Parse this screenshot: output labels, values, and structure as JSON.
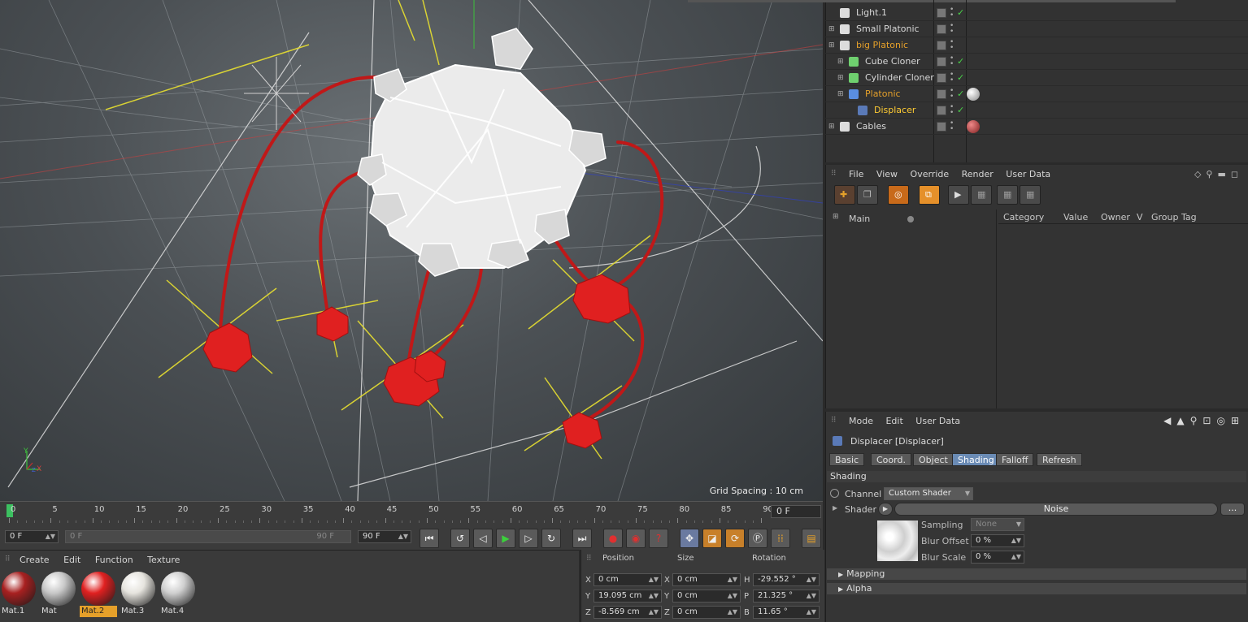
{
  "viewport": {
    "grid_spacing": "Grid Spacing : 10 cm",
    "axis_y": "Y",
    "axis_x": "X",
    "axis_z": "Z"
  },
  "timeline": {
    "ticks": [
      "0",
      "5",
      "10",
      "15",
      "20",
      "25",
      "30",
      "35",
      "40",
      "45",
      "50",
      "55",
      "60",
      "65",
      "70",
      "75",
      "80",
      "85",
      "90"
    ],
    "current_frame": "0 F"
  },
  "transport": {
    "start_frame": "0 F",
    "range_start": "0 F",
    "range_end": "90 F",
    "end_frame": "90 F"
  },
  "materials": {
    "menu": [
      "Create",
      "Edit",
      "Function",
      "Texture"
    ],
    "items": [
      {
        "label": "Mat.1",
        "color": "#a82020"
      },
      {
        "label": "Mat",
        "color": "#c8c8c8"
      },
      {
        "label": "Mat.2",
        "color": "#e02020"
      },
      {
        "label": "Mat.3",
        "color": "#e6e4de"
      },
      {
        "label": "Mat.4",
        "color": "#d0d0d0"
      }
    ]
  },
  "coordinates": {
    "headers": {
      "position": "Position",
      "size": "Size",
      "rotation": "Rotation"
    },
    "rows": [
      {
        "axis": "X",
        "pos": "0 cm",
        "size_axis": "X",
        "size": "0 cm",
        "rot_axis": "H",
        "rot": "-29.552 °"
      },
      {
        "axis": "Y",
        "pos": "19.095 cm",
        "size_axis": "Y",
        "size": "0 cm",
        "rot_axis": "P",
        "rot": "21.325 °"
      },
      {
        "axis": "Z",
        "pos": "-8.569 cm",
        "size_axis": "Z",
        "size": "0 cm",
        "rot_axis": "B",
        "rot": "11.65 °"
      }
    ]
  },
  "objects": [
    {
      "name": "Light.1",
      "style": "normal",
      "check": true
    },
    {
      "name": "Small Platonic",
      "style": "normal",
      "check": false
    },
    {
      "name": "big Platonic",
      "style": "hl",
      "check": false
    },
    {
      "name": "Cube Cloner",
      "style": "normal",
      "check": true
    },
    {
      "name": "Cylinder Cloner",
      "style": "normal",
      "check": true
    },
    {
      "name": "Platonic",
      "style": "hl",
      "check": true
    },
    {
      "name": "Displacer",
      "style": "sel",
      "check": true
    },
    {
      "name": "Cables",
      "style": "normal",
      "check": false
    }
  ],
  "tag_manager": {
    "menu": [
      "File",
      "View",
      "Override",
      "Render",
      "User Data"
    ],
    "tree_item": "Main",
    "columns": [
      "Category",
      "Value",
      "Owner",
      "V",
      "Group Tag"
    ]
  },
  "attributes": {
    "menu": [
      "Mode",
      "Edit",
      "User Data"
    ],
    "title": "Displacer [Displacer]",
    "tabs": [
      "Basic",
      "Coord.",
      "Object",
      "Shading",
      "Falloff",
      "Refresh"
    ],
    "active_tab": "Shading",
    "section_shading": "Shading",
    "channel_label": "Channel",
    "channel_value": "Custom Shader",
    "shader_label": "Shader",
    "shader_value": "Noise",
    "shader_more": "...",
    "sampling_label": "Sampling",
    "sampling_value": "None",
    "blur_offset_label": "Blur Offset",
    "blur_offset_value": "0 %",
    "blur_scale_label": "Blur Scale",
    "blur_scale_value": "0 %",
    "section_mapping": "Mapping",
    "section_alpha": "Alpha"
  }
}
